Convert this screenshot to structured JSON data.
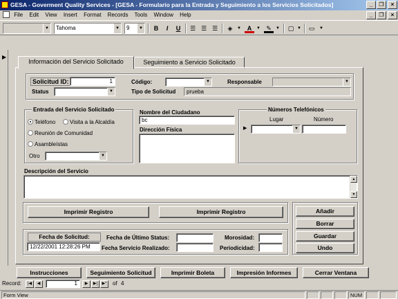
{
  "window": {
    "title": "GESA - Goverment Quality Services - [GESA - Formulario para la Entrada y Seguimiento a los Servicios Solicitados]",
    "min": "_",
    "restore": "❐",
    "close": "×"
  },
  "menu": [
    "File",
    "Edit",
    "View",
    "Insert",
    "Format",
    "Records",
    "Tools",
    "Window",
    "Help"
  ],
  "toolbar": {
    "object_combo": "",
    "font": "Tahoma",
    "size": "9",
    "bold": "B",
    "italic": "I",
    "underline": "U"
  },
  "tabs": [
    "Información del Servicio Solicitado",
    "Seguimiento a Servicio Solicitado"
  ],
  "header": {
    "solicitud_label": "Solicitud ID:",
    "solicitud_value": "1",
    "status_label": "Status",
    "status_value": "",
    "codigo_label": "Código:",
    "codigo_value": "",
    "responsable_label": "Responsable",
    "responsable_value": "",
    "tipo_label": "Tipo de Solicitud",
    "tipo_value": "prueba"
  },
  "entrada": {
    "title": "Entrada del Servicio Solicitado",
    "options": [
      "Teléfono",
      "Visita a la Alcaldía",
      "Reunión de Comunidad",
      "Asambleístas"
    ],
    "selected": "Teléfono",
    "otro_label": "Otro",
    "otro_value": ""
  },
  "ciudadano": {
    "nombre_label": "Nombre del Ciudadano",
    "nombre_value": "bc",
    "direccion_label": "Dirección Física",
    "direccion_value": ""
  },
  "telefonos": {
    "title": "Números Telefónicos",
    "col_lugar": "Lugar",
    "col_numero": "Número",
    "row_marker": "▶"
  },
  "descripcion": {
    "label": "Descripción del Servicio",
    "value": ""
  },
  "print_buttons": [
    "Imprimir Registro",
    "Imprimir Registro"
  ],
  "fechas": {
    "solicitud_label": "Fecha de Solicitud:",
    "solicitud_value": "12/22/2001 12:28:26 PM",
    "ultimo_status_label": "Fecha de Último Status:",
    "ultimo_status_value": "",
    "realizado_label": "Fecha Servicio Realizado:",
    "realizado_value": "",
    "morosidad_label": "Morosidad:",
    "morosidad_value": "",
    "periodicidad_label": "Periodicidad:",
    "periodicidad_value": ""
  },
  "actions": [
    "Añadir",
    "Borrar",
    "Guardar",
    "Undo"
  ],
  "bottom_buttons": [
    "Instrucciones",
    "Seguimiento Solicitud",
    "Imprimir Boleta",
    "Impresión Informes",
    "Cerrar Ventana"
  ],
  "navigation": {
    "label": "Record:",
    "current": "1",
    "of_label": "of",
    "total": "4"
  },
  "status": {
    "view": "Form View",
    "num": "NUM"
  }
}
